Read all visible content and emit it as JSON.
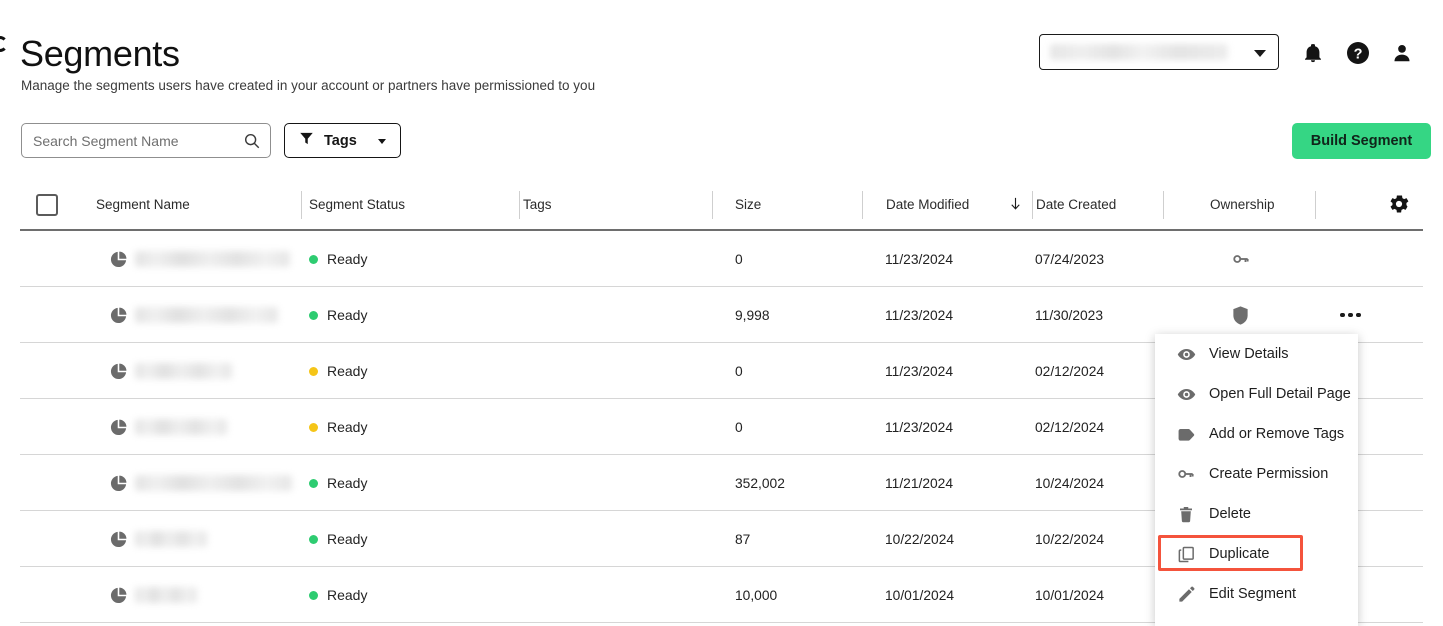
{
  "header": {
    "title": "Segments",
    "subtitle": "Manage the segments users have created in your account or partners have permissioned to you",
    "account_selector": {
      "value": "",
      "redacted": true,
      "icon": "chevron-down-icon"
    },
    "icons": [
      "bell-icon",
      "help-circle-icon",
      "user-icon"
    ]
  },
  "toolbar": {
    "search": {
      "value": "",
      "placeholder": "Search Segment Name",
      "icon": "search-icon"
    },
    "tags_button": {
      "label": "Tags",
      "icon": "filter-funnel-icon",
      "caret": "chevron-down-icon"
    },
    "build_button": {
      "label": "Build Segment",
      "color": "#35d684"
    }
  },
  "table": {
    "select_all": {
      "checked": false
    },
    "settings_icon": "gear-icon",
    "columns": [
      {
        "key": "name",
        "label": "Segment Name"
      },
      {
        "key": "status",
        "label": "Segment Status"
      },
      {
        "key": "tags",
        "label": "Tags"
      },
      {
        "key": "size",
        "label": "Size"
      },
      {
        "key": "modified",
        "label": "Date Modified",
        "sort": "desc",
        "sort_icon": "arrow-down-icon"
      },
      {
        "key": "created",
        "label": "Date Created"
      },
      {
        "key": "ownership",
        "label": "Ownership"
      }
    ],
    "rows": [
      {
        "name": "",
        "name_redacted": true,
        "name_width": 155,
        "icon": "pie-chart-icon",
        "status": "Ready",
        "status_color": "#2ecc71",
        "tags": "",
        "size": "0",
        "modified": "11/23/2024",
        "created": "07/24/2023",
        "ownership_icon": "key-icon"
      },
      {
        "name": "",
        "name_redacted": true,
        "name_width": 143,
        "icon": "pie-chart-icon",
        "status": "Ready",
        "status_color": "#2ecc71",
        "tags": "",
        "size": "9,998",
        "modified": "11/23/2024",
        "created": "11/30/2023",
        "ownership_icon": "shield-icon",
        "has_menu": true
      },
      {
        "name": "",
        "name_redacted": true,
        "name_width": 97,
        "icon": "pie-chart-icon",
        "status": "Ready",
        "status_color": "#f5c518",
        "tags": "",
        "size": "0",
        "modified": "11/23/2024",
        "created": "02/12/2024",
        "ownership_icon": ""
      },
      {
        "name": "",
        "name_redacted": true,
        "name_width": 92,
        "icon": "pie-chart-icon",
        "status": "Ready",
        "status_color": "#f5c518",
        "tags": "",
        "size": "0",
        "modified": "11/23/2024",
        "created": "02/12/2024",
        "ownership_icon": ""
      },
      {
        "name": "",
        "name_redacted": true,
        "name_width": 157,
        "icon": "pie-chart-icon",
        "status": "Ready",
        "status_color": "#2ecc71",
        "tags": "",
        "size": "352,002",
        "modified": "11/21/2024",
        "created": "10/24/2024",
        "ownership_icon": ""
      },
      {
        "name": "",
        "name_redacted": true,
        "name_width": 72,
        "icon": "pie-chart-icon",
        "status": "Ready",
        "status_color": "#2ecc71",
        "tags": "",
        "size": "87",
        "modified": "10/22/2024",
        "created": "10/22/2024",
        "ownership_icon": ""
      },
      {
        "name": "",
        "name_redacted": true,
        "name_width": 62,
        "icon": "pie-chart-icon",
        "status": "Ready",
        "status_color": "#2ecc71",
        "tags": "",
        "size": "10,000",
        "modified": "10/01/2024",
        "created": "10/01/2024",
        "ownership_icon": ""
      }
    ]
  },
  "context_menu": {
    "highlight_color": "#f4533c",
    "highlighted_item": "Duplicate",
    "items": [
      {
        "label": "View Details",
        "icon": "eye-icon"
      },
      {
        "label": "Open Full Detail Page",
        "icon": "eye-icon"
      },
      {
        "label": "Add or Remove Tags",
        "icon": "tag-icon"
      },
      {
        "label": "Create Permission",
        "icon": "key-icon"
      },
      {
        "label": "Delete",
        "icon": "trash-icon"
      },
      {
        "label": "Duplicate",
        "icon": "copy-icon"
      },
      {
        "label": "Edit Segment",
        "icon": "pencil-icon"
      }
    ]
  }
}
